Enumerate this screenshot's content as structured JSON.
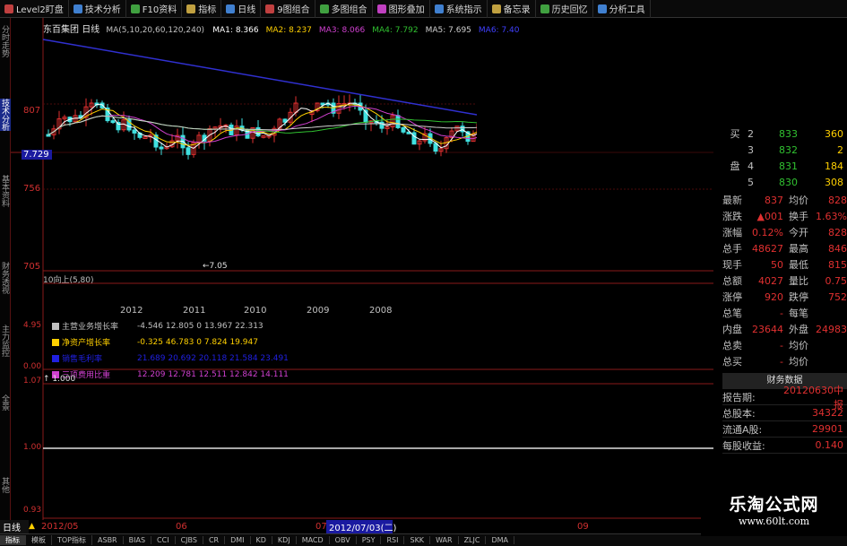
{
  "toolbar": {
    "items": [
      {
        "label": "Level2盯盘",
        "icon": "level2-icon"
      },
      {
        "label": "技术分析",
        "icon": "chart-icon"
      },
      {
        "label": "F10资料",
        "icon": "info-icon"
      },
      {
        "label": "指标",
        "icon": "indicator-icon"
      },
      {
        "label": "日线",
        "icon": "period-icon"
      },
      {
        "label": "9图组合",
        "icon": "grid-icon"
      },
      {
        "label": "多图组合",
        "icon": "multi-icon"
      },
      {
        "label": "图形叠加",
        "icon": "overlay-icon"
      },
      {
        "label": "系统指示",
        "icon": "system-icon"
      },
      {
        "label": "备忘录",
        "icon": "memo-icon"
      },
      {
        "label": "历史回忆",
        "icon": "history-icon"
      },
      {
        "label": "分析工具",
        "icon": "tool-icon"
      }
    ]
  },
  "left_tabs": [
    "分时走势",
    "技术分析",
    "基本资料",
    "财务透视",
    "主力监控",
    "全景",
    "其他"
  ],
  "stock": {
    "name": "东百集团",
    "period": "日线",
    "ma_label": "MA(5,10,20,60,120,240)",
    "ma_values": [
      {
        "label": "MA1:",
        "value": "8.366",
        "color": "#ffffff"
      },
      {
        "label": "MA2:",
        "value": "8.237",
        "color": "#ffd000"
      },
      {
        "label": "MA3:",
        "value": "8.066",
        "color": "#d040d0"
      },
      {
        "label": "MA4:",
        "value": "7.792",
        "color": "#30c030"
      },
      {
        "label": "MA5:",
        "value": "7.695",
        "color": "#d0d0d0"
      },
      {
        "label": "MA6:",
        "value": "7.40",
        "color": "#4040ff"
      }
    ]
  },
  "price_axis": {
    "labels": [
      "807",
      "7.729",
      "756",
      "705"
    ],
    "low_label": "7.05"
  },
  "indicator": {
    "label": "10向上(5,80)"
  },
  "years": [
    "2012",
    "2011",
    "2010",
    "2009",
    "2008"
  ],
  "fin_rows": [
    {
      "name": "主营业务增长率",
      "values": "-4.546 12.805 0 13.967 22.313",
      "color": "#c0c0c0"
    },
    {
      "name": "净资产增长率",
      "values": "-0.325 46.783 0 7.824 19.947",
      "color": "#ffd000"
    },
    {
      "name": "销售毛利率",
      "values": "21.689 20.692 20.118 21.584 23.491",
      "color": "#2020e0"
    },
    {
      "name": "三项费用比重",
      "values": "12.209 12.781 12.511 12.842 14.111",
      "color": "#d040d0"
    }
  ],
  "fin_axis": {
    "labels": [
      "4.95",
      "0.00"
    ]
  },
  "sub_axis": {
    "labels": [
      "1.07",
      "1.00",
      "0.93"
    ],
    "current_label": "1.000"
  },
  "quote": {
    "asks": [
      {
        "label": "买",
        "n": "2",
        "price": "833",
        "vol": "360"
      },
      {
        "label": "",
        "n": "3",
        "price": "832",
        "vol": "2"
      },
      {
        "label": "盘",
        "n": "4",
        "price": "831",
        "vol": "184"
      },
      {
        "label": "",
        "n": "5",
        "price": "830",
        "vol": "308"
      }
    ],
    "stats": [
      {
        "l1": "最新",
        "v1": "837",
        "l2": "均价",
        "v2": "828"
      },
      {
        "l1": "涨跌",
        "v1": "▲001",
        "l2": "换手",
        "v2": "1.63%"
      },
      {
        "l1": "涨幅",
        "v1": "0.12%",
        "l2": "今开",
        "v2": "828"
      },
      {
        "l1": "总手",
        "v1": "48627",
        "l2": "最高",
        "v2": "846"
      },
      {
        "l1": "现手",
        "v1": "50",
        "l2": "最低",
        "v2": "815"
      },
      {
        "l1": "总额",
        "v1": "4027",
        "l2": "量比",
        "v2": "0.75"
      },
      {
        "l1": "涨停",
        "v1": "920",
        "l2": "跌停",
        "v2": "752"
      },
      {
        "l1": "总笔",
        "v1": "-",
        "l2": "每笔",
        "v2": ""
      },
      {
        "l1": "内盘",
        "v1": "23644",
        "l2": "外盘",
        "v2": "24983"
      },
      {
        "l1": "总卖",
        "v1": "-",
        "l2": "均价",
        "v2": ""
      },
      {
        "l1": "总买",
        "v1": "-",
        "l2": "均价",
        "v2": ""
      }
    ],
    "fin_title": "财务数据",
    "fin": [
      {
        "label": "报告期:",
        "value": "20120630中报"
      },
      {
        "label": "总股本:",
        "value": "34322"
      },
      {
        "label": "流通A股:",
        "value": "29901"
      },
      {
        "label": "每股收益:",
        "value": "0.140"
      }
    ]
  },
  "bottom": {
    "period": "日线",
    "date_left": "2012/05",
    "month_06": "06",
    "month_07": "07",
    "current_date": "2012/07/03(二)",
    "month_09": "09",
    "tabs": [
      "指标",
      "模板",
      "TOP指标",
      "ASBR",
      "BIAS",
      "CCI",
      "CJBS",
      "CR",
      "DMI",
      "KD",
      "KDJ",
      "MACD",
      "OBV",
      "PSY",
      "RSI",
      "SKK",
      "WAR",
      "ZLJC",
      "DMA"
    ]
  },
  "watermark": {
    "title": "乐淘公式网",
    "url": "www.60lt.com"
  }
}
